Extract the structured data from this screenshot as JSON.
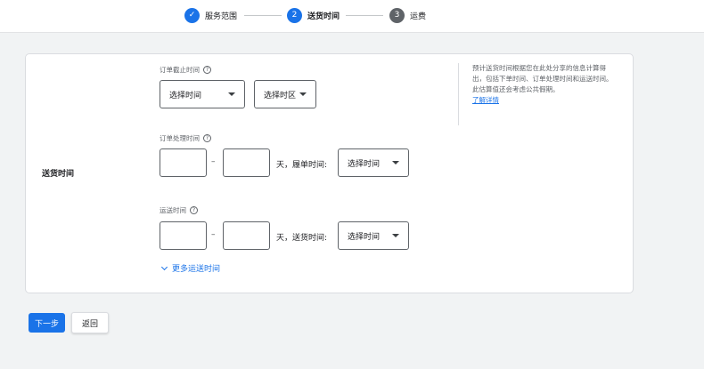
{
  "stepper": {
    "steps": [
      {
        "label": "服务范围",
        "state": "done",
        "number": ""
      },
      {
        "label": "送货时间",
        "state": "active",
        "number": "2"
      },
      {
        "label": "运费",
        "state": "todo",
        "number": "3"
      }
    ],
    "check_glyph": "✓"
  },
  "section": {
    "title": "送货时间",
    "cutoff": {
      "label": "订单截止时间",
      "help": "?",
      "time_select": "选择时间",
      "zone_select": "选择时区"
    },
    "handling": {
      "label": "订单处理时间",
      "help": "?",
      "min_value": "",
      "max_value": "",
      "dash": "–",
      "suffix": "天，履单时间:",
      "time_select": "选择时间"
    },
    "transit": {
      "label": "运送时间",
      "help": "?",
      "min_value": "",
      "max_value": "",
      "dash": "–",
      "suffix": "天，送货时间:",
      "time_select": "选择时间"
    },
    "more_link": "更多运送时间",
    "info_text": "预计送货时间根据您在此处分享的信息计算得出，包括下单时间、订单处理时间和运送时间。此估算值还会考虑公共假期。",
    "info_link": "了解详情"
  },
  "footer": {
    "next_label": "下一步",
    "back_label": "返回"
  },
  "colors": {
    "accent": "#1a73e8",
    "todo_step": "#5f6368",
    "background": "#f1f3f4"
  }
}
